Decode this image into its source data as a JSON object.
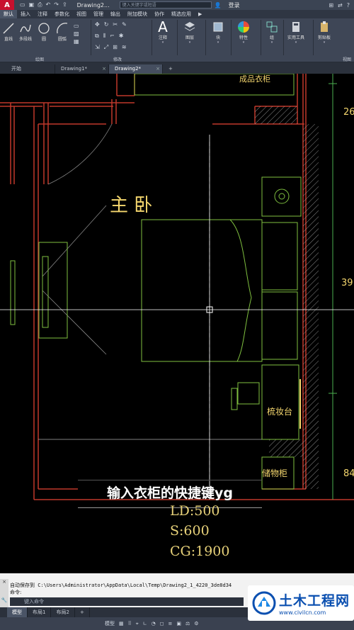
{
  "titlebar": {
    "app_logo": "A",
    "doc_title": "Drawing2...",
    "search_placeholder": "键入关键字或短语",
    "login": "登录"
  },
  "menubar": {
    "items": [
      "默认",
      "插入",
      "注释",
      "参数化",
      "视图",
      "管理",
      "输出",
      "附加模块",
      "协作",
      "精选应用"
    ]
  },
  "ribbon": {
    "tools": {
      "line": "直线",
      "polyline": "多段线",
      "circle": "圆",
      "arc": "圆弧",
      "annotate": "注释",
      "layers": "图层",
      "block": "块",
      "properties": "特性",
      "group": "组",
      "utilities": "实用工具",
      "clipboard": "剪贴板"
    },
    "panels": {
      "draw": "绘图",
      "modify": "修改",
      "view": "视图"
    }
  },
  "file_tabs": {
    "items": [
      {
        "label": "开始",
        "active": false
      },
      {
        "label": "Drawing1*",
        "active": false
      },
      {
        "label": "Drawing2*",
        "active": true
      }
    ],
    "add": "+"
  },
  "drawing": {
    "room_label": "主 卧",
    "wardrobe_label": "成品衣柜",
    "dresser_label": "梳妆台",
    "storage_label": "储物柜",
    "dim_top": "26",
    "dim_mid": "39",
    "dim_bottom": "84"
  },
  "overlay": {
    "title": "输入衣柜的快捷键yg",
    "spec_ld": "LD:500",
    "spec_s": "S:600",
    "spec_cg": "CG:1900"
  },
  "command": {
    "autosave": "自动保存到 C:\\Users\\Administrator\\AppData\\Local\\Temp\\Drawing2_1_4220_3de8d34",
    "prompt": "命令:",
    "input_placeholder": "键入命令"
  },
  "layout_tabs": {
    "items": [
      {
        "label": "模型",
        "active": true
      },
      {
        "label": "布局1",
        "active": false
      },
      {
        "label": "布局2",
        "active": false
      }
    ],
    "add": "+"
  },
  "statusbar": {
    "model": "模型"
  },
  "watermark": {
    "name": "土木工程网",
    "url": "www.civilcn.com"
  },
  "colors": {
    "wall": "#c0392b",
    "furniture": "#7fbf3f",
    "text_yellow": "#f5d76e",
    "crosshair": "#ffffff"
  }
}
